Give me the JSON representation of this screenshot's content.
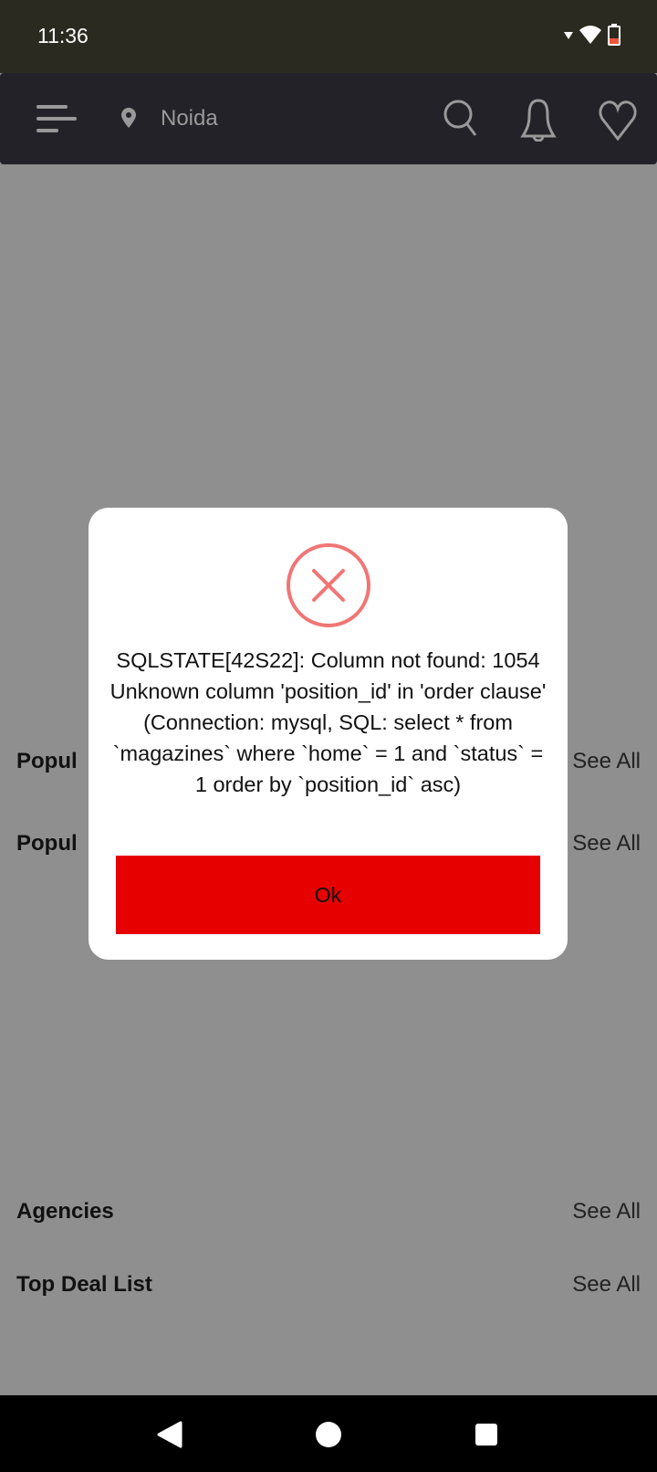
{
  "status_bar": {
    "time": "11:36",
    "icons": [
      "signal-icon",
      "wifi-icon",
      "battery-low-icon"
    ]
  },
  "header": {
    "location": "Noida",
    "icons": [
      "menu-icon",
      "location-pin-icon",
      "search-icon",
      "bell-icon",
      "heart-icon"
    ]
  },
  "sections": [
    {
      "title": "Popul",
      "see_all": "See All"
    },
    {
      "title": "Popul",
      "see_all": "See All"
    },
    {
      "title": "Agencies",
      "see_all": "See All"
    },
    {
      "title": "Top Deal List",
      "see_all": "See All"
    }
  ],
  "dialog": {
    "icon": "error-x-icon",
    "message": "SQLSTATE[42S22]: Column not found: 1054 Unknown column 'position_id' in 'order clause' (Connection: mysql, SQL: select * from `magazines` where `home` = 1 and `status` = 1 order by `position_id` asc)",
    "ok_label": "Ok",
    "colors": {
      "button": "#e60000",
      "icon": "#f07575"
    }
  },
  "nav_bar": {
    "icons": [
      "back-icon",
      "home-icon",
      "recents-icon"
    ]
  }
}
